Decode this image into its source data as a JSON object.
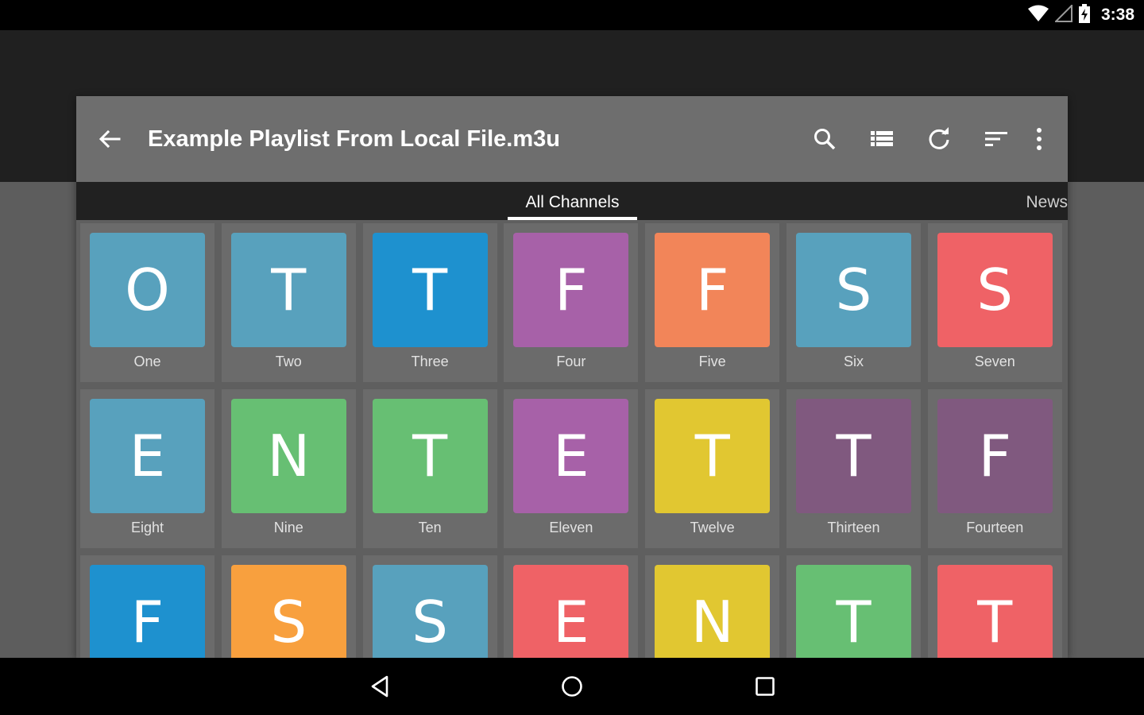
{
  "status_bar": {
    "time": "3:38",
    "icons": [
      "wifi-icon",
      "signal-icon",
      "battery-charging-icon"
    ]
  },
  "toolbar": {
    "title": "Example Playlist From Local File.m3u",
    "icons": [
      "arrow-back-icon",
      "search-icon",
      "list-view-icon",
      "refresh-icon",
      "sort-icon",
      "more-vert-icon"
    ]
  },
  "tabs": [
    {
      "label": "All Channels",
      "selected": true
    },
    {
      "label": "News",
      "selected": false
    }
  ],
  "channels": [
    {
      "letter": "O",
      "name": "One",
      "color": "#58a1bd"
    },
    {
      "letter": "T",
      "name": "Two",
      "color": "#58a1bd"
    },
    {
      "letter": "T",
      "name": "Three",
      "color": "#1e91cf"
    },
    {
      "letter": "F",
      "name": "Four",
      "color": "#a761a8"
    },
    {
      "letter": "F",
      "name": "Five",
      "color": "#f28559"
    },
    {
      "letter": "S",
      "name": "Six",
      "color": "#58a1bd"
    },
    {
      "letter": "S",
      "name": "Seven",
      "color": "#ef6266"
    },
    {
      "letter": "E",
      "name": "Eight",
      "color": "#58a1bd"
    },
    {
      "letter": "N",
      "name": "Nine",
      "color": "#67bf73"
    },
    {
      "letter": "T",
      "name": "Ten",
      "color": "#67bf73"
    },
    {
      "letter": "E",
      "name": "Eleven",
      "color": "#a761a8"
    },
    {
      "letter": "T",
      "name": "Twelve",
      "color": "#e1c731"
    },
    {
      "letter": "T",
      "name": "Thirteen",
      "color": "#80597f"
    },
    {
      "letter": "F",
      "name": "Fourteen",
      "color": "#80597f"
    },
    {
      "letter": "F",
      "name": "",
      "color": "#1e91cf"
    },
    {
      "letter": "S",
      "name": "",
      "color": "#f8a03e"
    },
    {
      "letter": "S",
      "name": "",
      "color": "#58a1bd"
    },
    {
      "letter": "E",
      "name": "",
      "color": "#ef6266"
    },
    {
      "letter": "N",
      "name": "",
      "color": "#e1c731"
    },
    {
      "letter": "T",
      "name": "",
      "color": "#67bf73"
    },
    {
      "letter": "T",
      "name": "",
      "color": "#ef6266"
    }
  ],
  "nav_bar": {
    "icons": [
      "back-triangle-icon",
      "home-circle-icon",
      "recents-square-icon"
    ]
  }
}
